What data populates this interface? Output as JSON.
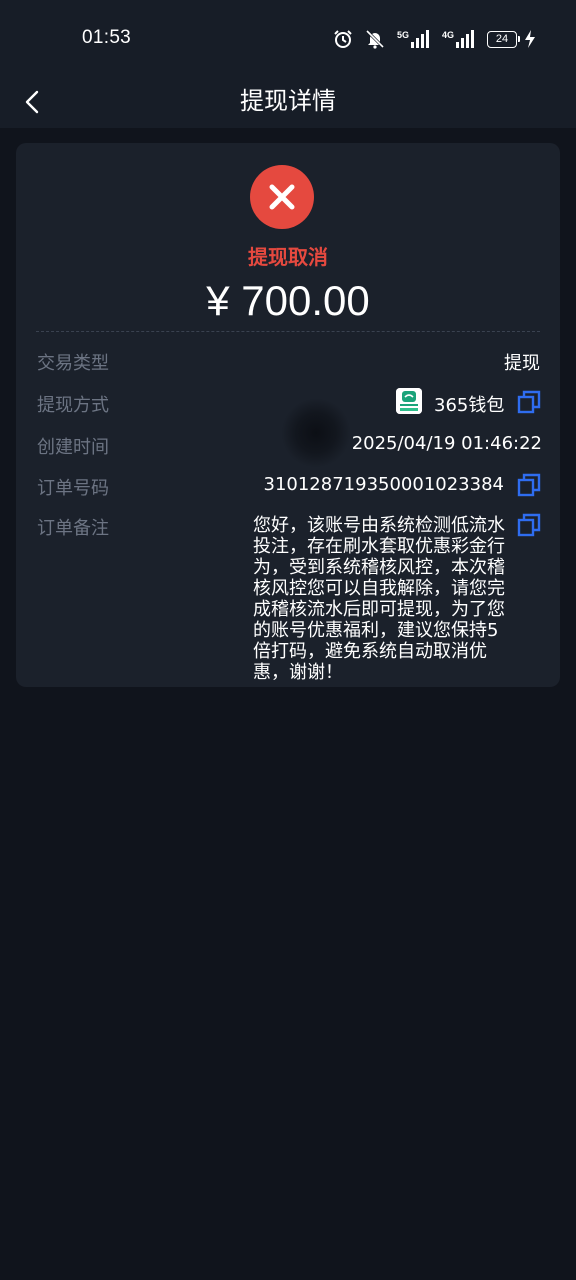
{
  "status_bar": {
    "time": "01:53",
    "battery": "24",
    "net1": "5G",
    "net2": "4G"
  },
  "nav": {
    "title": "提现详情"
  },
  "detail": {
    "status": "提现取消",
    "amount": "¥ 700.00",
    "rows": {
      "type": {
        "label": "交易类型",
        "value": "提现"
      },
      "method": {
        "label": "提现方式",
        "value": "365钱包"
      },
      "created": {
        "label": "创建时间",
        "value": "2025/04/19 01:46:22"
      },
      "order": {
        "label": "订单号码",
        "value": "310128719350001023384"
      },
      "remark": {
        "label": "订单备注",
        "value": "您好，该账号由系统检测低流水投注，存在刷水套取优惠彩金行为，受到系统稽核风控，本次稽核风控您可以自我解除，请您完成稽核流水后即可提现，为了您的账号优惠福利，建议您保持5倍打码，避免系统自动取消优惠，谢谢！"
      }
    }
  },
  "colors": {
    "accent_red": "#e5493f",
    "copy_blue": "#2f6df0",
    "background": "#10141c",
    "card": "#1b212b"
  }
}
